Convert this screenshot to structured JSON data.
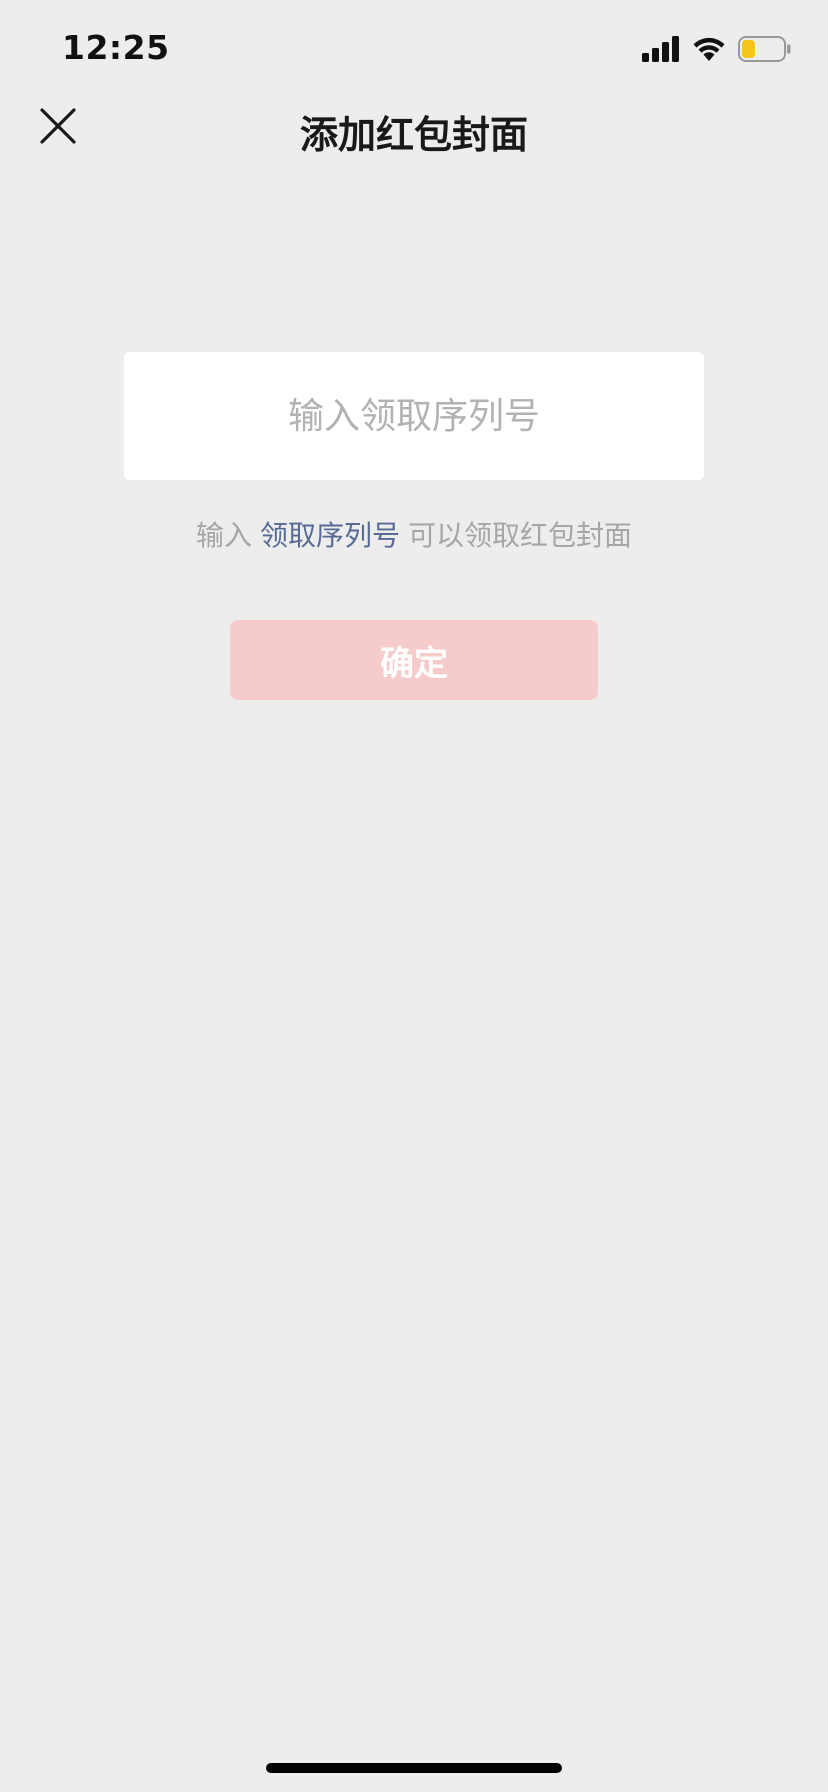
{
  "status_bar": {
    "time": "12:25",
    "icons": [
      "signal-icon",
      "wifi-icon",
      "battery-icon"
    ],
    "battery_color": "#f5c518"
  },
  "nav": {
    "title": "添加红包封面",
    "close_icon": "close-icon"
  },
  "form": {
    "input_placeholder": "输入领取序列号",
    "input_value": "",
    "hint_prefix": "输入",
    "hint_link": "领取序列号",
    "hint_suffix": "可以领取红包封面",
    "confirm_label": "确定"
  },
  "colors": {
    "background": "#ededed",
    "link": "#576b95",
    "button_disabled": "#f5cbcb"
  }
}
